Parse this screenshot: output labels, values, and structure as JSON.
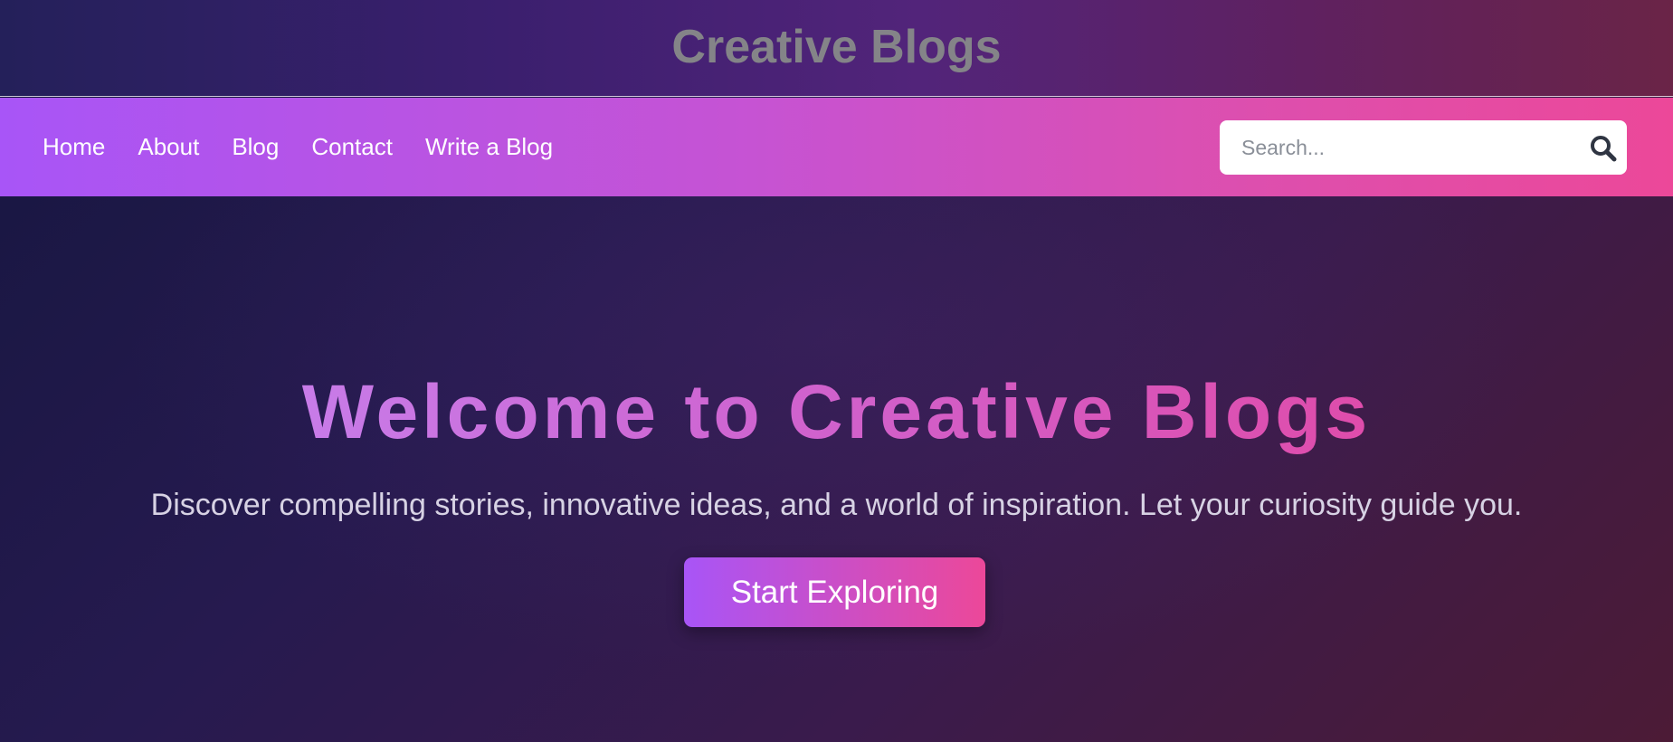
{
  "header": {
    "site_title": "Creative Blogs"
  },
  "nav": {
    "links": [
      {
        "label": "Home"
      },
      {
        "label": "About"
      },
      {
        "label": "Blog"
      },
      {
        "label": "Contact"
      },
      {
        "label": "Write a Blog"
      }
    ]
  },
  "search": {
    "placeholder": "Search...",
    "value": "",
    "icon": "search-icon"
  },
  "hero": {
    "title": "Welcome to Creative Blogs",
    "subtitle": "Discover compelling stories, innovative ideas, and a world of inspiration. Let your curiosity guide you.",
    "cta_label": "Start Exploring"
  },
  "colors": {
    "accent_start": "#a855f7",
    "accent_end": "#ec4899",
    "site_title": "#848488",
    "subtitle": "#d7d2e4"
  }
}
